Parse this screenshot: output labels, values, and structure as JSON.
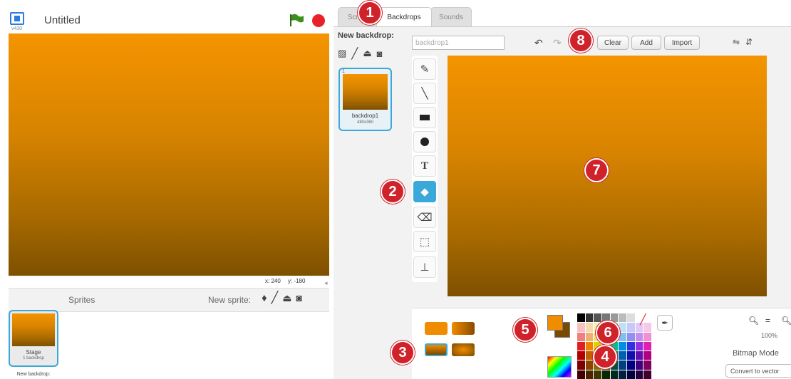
{
  "stage": {
    "title": "Untitled",
    "version_label": "v430",
    "coord_x": "x: 240",
    "coord_y": "y: -180",
    "canvas_colors": [
      "#f49400",
      "#7e5000"
    ]
  },
  "sprites_panel": {
    "label": "Sprites",
    "new_sprite_label": "New sprite:",
    "stage_thumb_name": "Stage",
    "stage_thumb_count": "1 backdrop",
    "new_backdrop_label": "New backdrop:"
  },
  "tabs": [
    {
      "label": "Scripts"
    },
    {
      "label": "Backdrops"
    },
    {
      "label": "Sounds"
    }
  ],
  "backdrop_list": {
    "new_backdrop_label": "New backdrop:",
    "items": [
      {
        "number": "1",
        "name": "backdrop1",
        "size": "480x360"
      }
    ]
  },
  "editor": {
    "name_value": "backdrop1",
    "buttons": {
      "clear": "Clear",
      "add": "Add",
      "import": "Import"
    },
    "tools": [
      "brush-icon",
      "line-icon",
      "rectangle-icon",
      "ellipse-icon",
      "text-icon",
      "fill-bucket-icon",
      "eraser-icon",
      "select-icon",
      "stamp-icon"
    ],
    "selected_tool": "fill-bucket-icon",
    "zoom": "100%",
    "mode": "Bitmap Mode",
    "convert_label": "Convert to vector",
    "fill_color": "#f08c00",
    "secondary_color": "#7a4a00"
  },
  "palette": [
    "#000000",
    "#333333",
    "#555555",
    "#777777",
    "#999999",
    "#bbbbbb",
    "#dddddd",
    "#ffffff",
    "#ffffff",
    "#f8c0c0",
    "#f8d8b0",
    "#f8f0b0",
    "#d8f0c0",
    "#c0f0e0",
    "#c0e0f8",
    "#c8c8f8",
    "#e0c8f8",
    "#f8c8e8",
    "#f08080",
    "#f0b070",
    "#f0e070",
    "#a0e080",
    "#80e0c0",
    "#80c0f0",
    "#9090f0",
    "#c090f0",
    "#f090d0",
    "#e02020",
    "#f08000",
    "#e0d000",
    "#40c000",
    "#00c090",
    "#0090e0",
    "#3030e0",
    "#9030e0",
    "#e020b0",
    "#b00000",
    "#c06000",
    "#b0a000",
    "#208000",
    "#008060",
    "#0060b0",
    "#1010b0",
    "#6010b0",
    "#b00080",
    "#800000",
    "#8a4500",
    "#807000",
    "#105000",
    "#005040",
    "#004080",
    "#000080",
    "#400080",
    "#800060",
    "#400000",
    "#4a2500",
    "#403800",
    "#082800",
    "#002820",
    "#002040",
    "#000040",
    "#200040",
    "#400030"
  ],
  "callouts": [
    "1",
    "2",
    "3",
    "4",
    "5",
    "6",
    "7",
    "8"
  ]
}
